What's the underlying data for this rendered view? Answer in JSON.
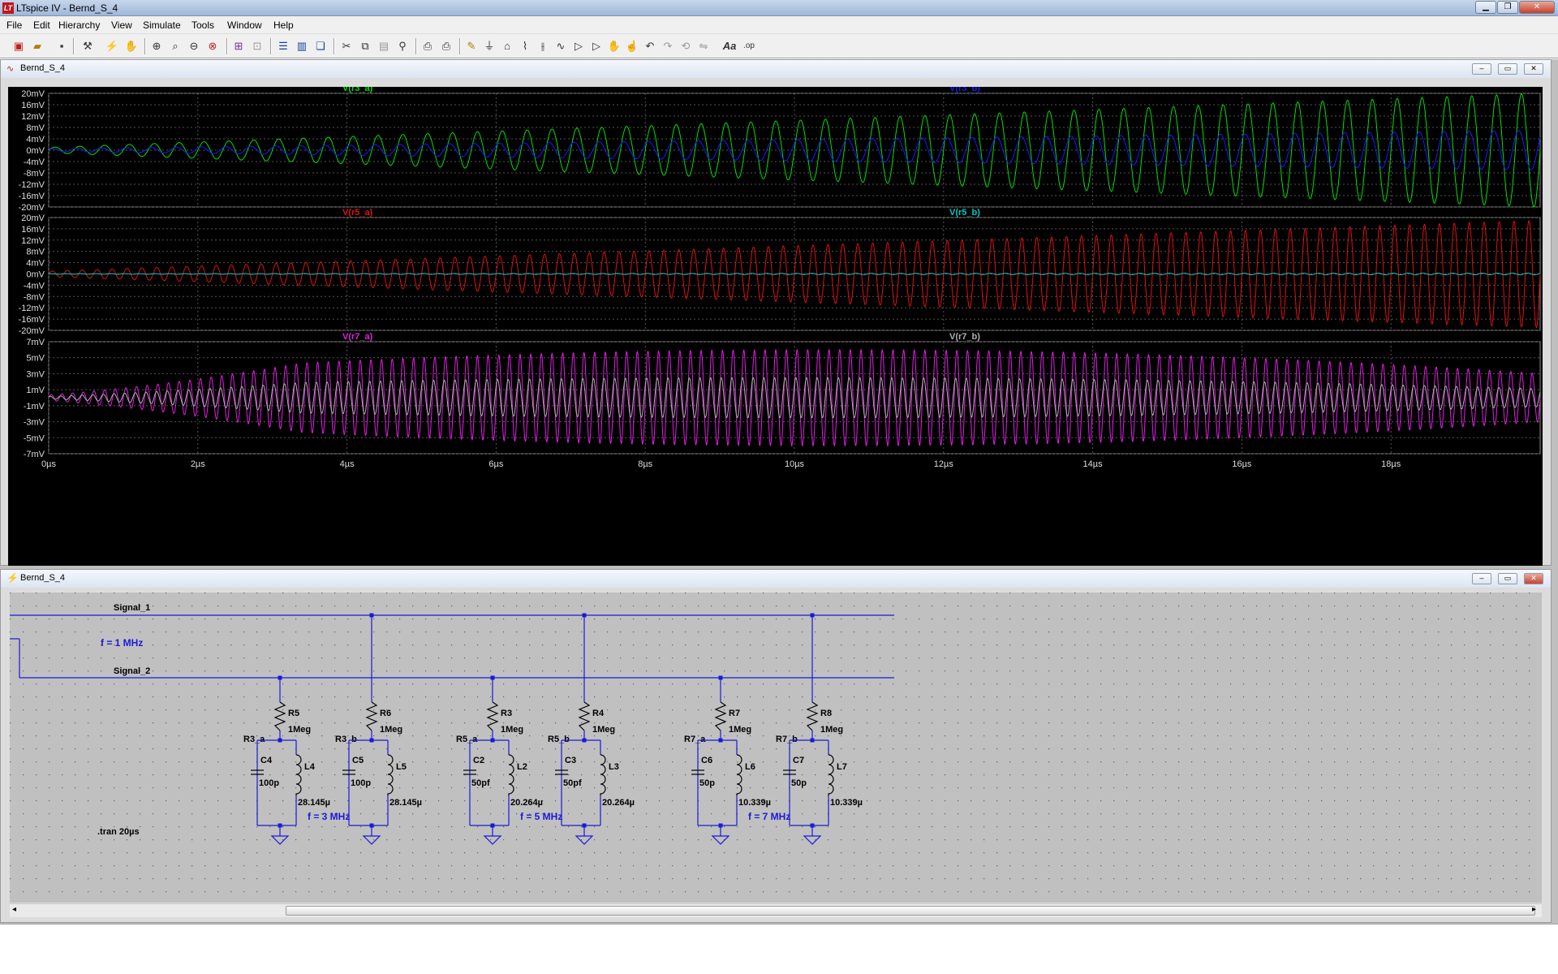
{
  "window": {
    "title": "LTspice IV - Bernd_S_4",
    "app_icon": "ltspice-icon",
    "buttons": [
      "minimize-icon",
      "maximize-icon",
      "close-icon"
    ]
  },
  "menu": [
    "File",
    "Edit",
    "Hierarchy",
    "View",
    "Simulate",
    "Tools",
    "Window",
    "Help"
  ],
  "toolbar": [
    "new-schematic-icon",
    "open-icon",
    "save-icon",
    "control-panel-icon",
    "run-icon",
    "halt-icon",
    "zoom-in-icon",
    "zoom-area-icon",
    "zoom-out-icon",
    "zoom-fit-icon",
    "autorange-icon",
    "grid-icon",
    "tile-horizontal-icon",
    "tile-vertical-icon",
    "cascade-icon",
    "cut-icon",
    "copy-icon",
    "paste-icon",
    "find-icon",
    "print-setup-icon",
    "print-icon",
    "wire-icon",
    "ground-icon",
    "label-icon",
    "resistor-icon",
    "capacitor-icon",
    "inductor-icon",
    "diode-icon",
    "component-icon",
    "move-icon",
    "drag-icon",
    "undo-icon",
    "redo-icon",
    "rotate-icon",
    "mirror-icon",
    "text-icon",
    "spice-directive-icon"
  ],
  "plot_window": {
    "title": "Bernd_S_4",
    "panes": [
      {
        "trace_left": "V(r3_a)",
        "trace_right": "V(r3_b)",
        "color_left": "#00e000",
        "color_right": "#1a1aff",
        "yticks": [
          "20mV",
          "16mV",
          "12mV",
          "8mV",
          "4mV",
          "0mV",
          "-4mV",
          "-8mV",
          "-12mV",
          "-16mV",
          "-20mV"
        ]
      },
      {
        "trace_left": "V(r5_a)",
        "trace_right": "V(r5_b)",
        "color_left": "#e01010",
        "color_right": "#00c8c8",
        "yticks": [
          "20mV",
          "16mV",
          "12mV",
          "8mV",
          "4mV",
          "0mV",
          "-4mV",
          "-8mV",
          "-12mV",
          "-16mV",
          "-20mV"
        ]
      },
      {
        "trace_left": "V(r7_a)",
        "trace_right": "V(r7_b)",
        "color_left": "#e020e0",
        "color_right": "#b0b0b0",
        "yticks": [
          "7mV",
          "5mV",
          "3mV",
          "1mV",
          "-1mV",
          "-3mV",
          "-5mV",
          "-7mV"
        ]
      }
    ],
    "xticks": [
      "0µs",
      "2µs",
      "4µs",
      "6µs",
      "8µs",
      "10µs",
      "12µs",
      "14µs",
      "16µs",
      "18µs"
    ]
  },
  "chart_data": {
    "type": "line",
    "xlabel": "",
    "xlim": [
      0,
      20
    ],
    "x_unit": "µs",
    "panes": [
      {
        "ylim": [
          -20,
          20
        ],
        "y_unit": "mV",
        "series": [
          {
            "name": "V(r3_a)",
            "freq_mhz": 3,
            "envelope_start_mv": 1,
            "envelope_end_mv": 20
          },
          {
            "name": "V(r3_b)",
            "freq_mhz": 3,
            "envelope_start_mv": 0.5,
            "envelope_end_mv": 7
          }
        ]
      },
      {
        "ylim": [
          -20,
          20
        ],
        "y_unit": "mV",
        "series": [
          {
            "name": "V(r5_a)",
            "freq_mhz": 5,
            "envelope_start_mv": 1,
            "envelope_end_mv": 19
          },
          {
            "name": "V(r5_b)",
            "freq_mhz": 5,
            "envelope_start_mv": 0.1,
            "envelope_end_mv": 0.3
          }
        ]
      },
      {
        "ylim": [
          -7,
          7
        ],
        "y_unit": "mV",
        "series": [
          {
            "name": "V(r7_a)",
            "freq_mhz": 7,
            "envelope_peak_mv": 6,
            "peak_at_us": 10.5
          },
          {
            "name": "V(r7_b)",
            "freq_mhz": 7,
            "envelope_peak_mv": 2.5,
            "peak_at_us": 10
          }
        ]
      }
    ]
  },
  "schematic_window": {
    "title": "Bernd_S_4",
    "labels": {
      "signal1": "Signal_1",
      "signal2": "Signal_2",
      "freq": "f = 1 MHz",
      "tran": ".tran 20µs"
    },
    "groups": [
      {
        "ra": "R5",
        "rb": "R6",
        "rval": "1Meg",
        "na": "R3_a",
        "nb": "R3_b",
        "ca": "C4",
        "cb": "C5",
        "cval": "100p",
        "la": "L4",
        "lb": "L5",
        "lval": "28.145µ",
        "freq": "f = 3 MHz"
      },
      {
        "ra": "R3",
        "rb": "R4",
        "rval": "1Meg",
        "na": "R5_a",
        "nb": "R5_b",
        "ca": "C2",
        "cb": "C3",
        "cval": "50pf",
        "la": "L2",
        "lb": "L3",
        "lval": "20.264µ",
        "freq": "f = 5 MHz"
      },
      {
        "ra": "R7",
        "rb": "R8",
        "rval": "1Meg",
        "na": "R7_a",
        "nb": "R7_b",
        "ca": "C6",
        "cb": "C7",
        "cval": "50p",
        "la": "L6",
        "lb": "L7",
        "lval": "10.339µ",
        "freq": "f = 7 MHz"
      }
    ]
  }
}
